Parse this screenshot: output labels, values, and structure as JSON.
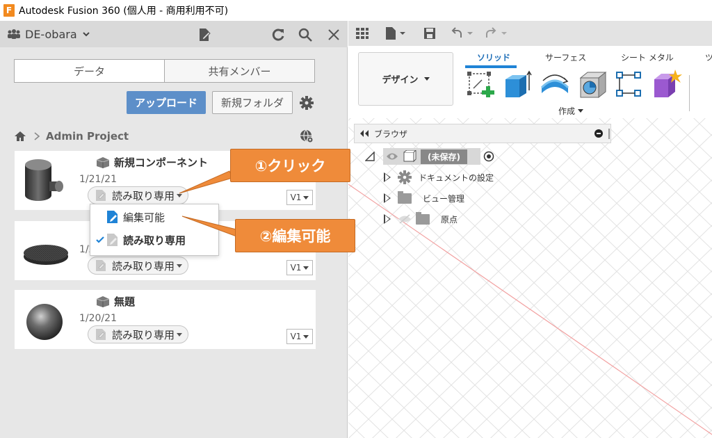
{
  "window": {
    "title": "Autodesk Fusion 360 (個人用 - 商用利用不可)",
    "logo_letter": "F"
  },
  "data_panel": {
    "team_name": "DE-obara",
    "tabs": [
      "データ",
      "共有メンバー"
    ],
    "active_tab": 0,
    "upload_label": "アップロード",
    "new_folder_label": "新規フォルダ",
    "breadcrumb": "Admin Project",
    "files": [
      {
        "name": "新規コンポーネント",
        "date": "1/21/21",
        "permission": "読み取り専用",
        "version": "V1"
      },
      {
        "name": "",
        "date": "1/2",
        "permission": "読み取り専用",
        "version": "V1"
      },
      {
        "name": "無題",
        "date": "1/20/21",
        "permission": "読み取り専用",
        "version": "V1"
      }
    ],
    "permission_menu": {
      "items": [
        {
          "label": "編集可能",
          "checked": false
        },
        {
          "label": "読み取り専用",
          "checked": true
        }
      ]
    }
  },
  "callouts": {
    "step1": "①クリック",
    "step2": "②編集可能",
    "color": "#ef8b3a"
  },
  "workspace": {
    "design_label": "デザイン",
    "ribbon_tabs": [
      "ソリッド",
      "サーフェス",
      "シート メタル",
      "ツ"
    ],
    "active_ribbon_tab": 0,
    "create_label": "作成",
    "browser": {
      "title": "ブラウザ",
      "root": "(未保存)",
      "items": [
        "ドキュメントの設定",
        "ビュー管理",
        "原点"
      ]
    }
  }
}
